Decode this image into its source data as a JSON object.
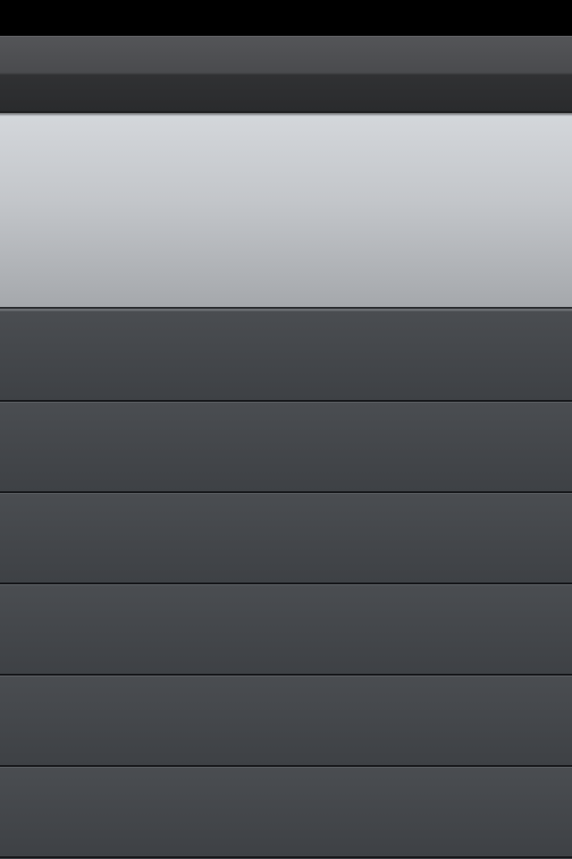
{
  "nav_bar": {
    "title": ""
  },
  "header_panel": {
    "text": ""
  },
  "list": {
    "rows": [
      {
        "label": ""
      },
      {
        "label": ""
      },
      {
        "label": ""
      },
      {
        "label": ""
      },
      {
        "label": ""
      },
      {
        "label": ""
      }
    ]
  },
  "colors": {
    "status_bar": "#000000",
    "nav_bar_top": "#545558",
    "nav_bar_bottom": "#2a2b2d",
    "header_panel_top": "#d4d7db",
    "header_panel_bottom": "#a5a8ac",
    "row_background": "#44474b",
    "row_separator": "#16171a"
  }
}
